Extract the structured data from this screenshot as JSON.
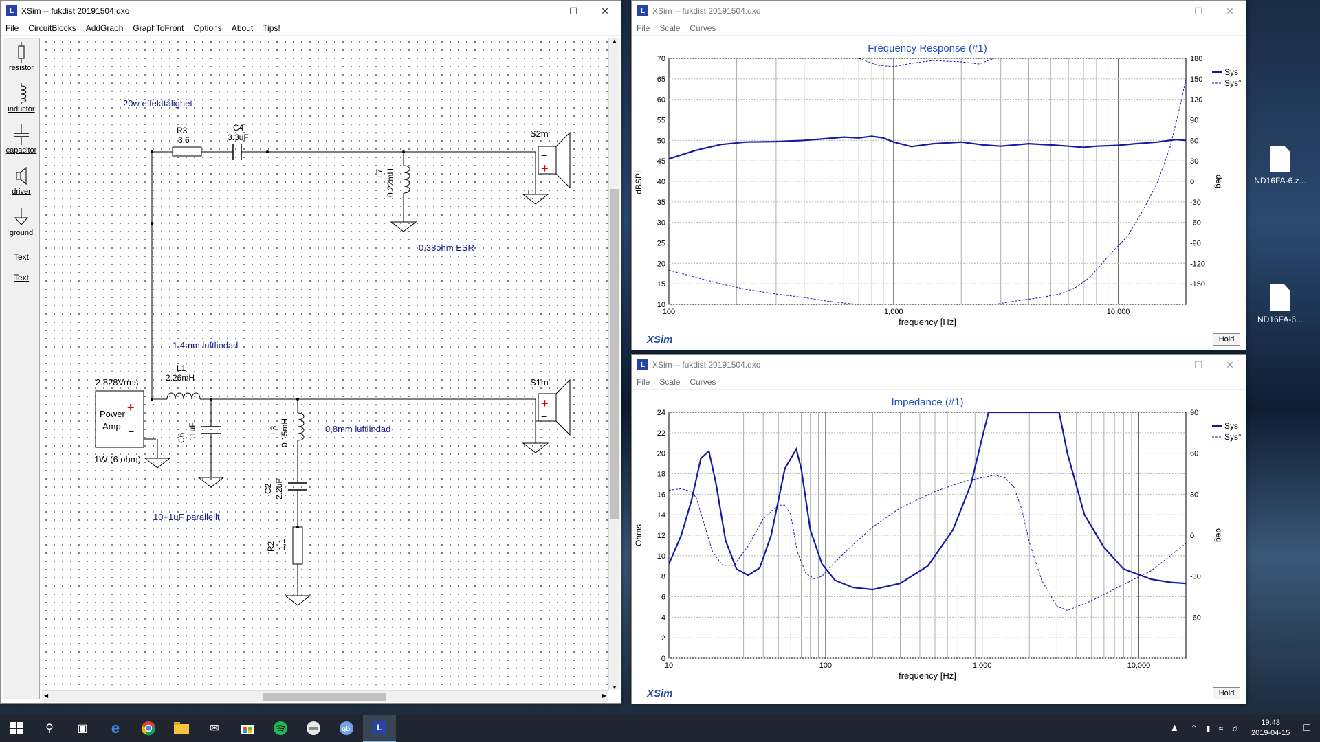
{
  "main_window": {
    "title": "XSim -- fukdist 20191504.dxo",
    "menu": [
      "File",
      "CircuitBlocks",
      "AddGraph",
      "GraphToFront",
      "Options",
      "About",
      "Tips!"
    ],
    "tools": [
      {
        "label": "resistor",
        "icon": "resistor-icon"
      },
      {
        "label": "inductor",
        "icon": "inductor-icon"
      },
      {
        "label": "capacitor",
        "icon": "capacitor-icon"
      },
      {
        "label": "driver",
        "icon": "driver-icon"
      },
      {
        "label": "ground",
        "icon": "ground-icon"
      },
      {
        "label": "Text",
        "icon": "text-glyph"
      },
      {
        "label": "Text",
        "icon": "text-underlined"
      }
    ],
    "annotations": {
      "power": "20w effekttålighet",
      "esr": "0,38ohm ESR",
      "l1_note": "1,4mm luftlindad",
      "l3_note": "0,8mm luftlindad",
      "c6_note": "10+1uF parallellt"
    },
    "components": {
      "r3": {
        "name": "R3",
        "value": "3.6"
      },
      "c4": {
        "name": "C4",
        "value": "3.3uF"
      },
      "l7": {
        "name": "L7",
        "value": "0.22mH"
      },
      "s2m": {
        "name": "S2m"
      },
      "l1": {
        "name": "L1",
        "value": "2.26mH"
      },
      "c6": {
        "name": "C6",
        "value": "11uF"
      },
      "l3": {
        "name": "L3",
        "value": "0.15mH"
      },
      "c2": {
        "name": "C2",
        "value": "2.2uF"
      },
      "r2": {
        "name": "R2",
        "value": "1.1"
      },
      "s1m": {
        "name": "S1m"
      },
      "amp": {
        "line1": "Power",
        "line2": "Amp",
        "voltage": "2.828Vrms",
        "load": "1W (6 ohm)"
      }
    }
  },
  "freq_window": {
    "title": "XSim -- fukdist 20191504.dxo",
    "menu": [
      "File",
      "Scale",
      "Curves"
    ],
    "logo": "XSim",
    "hold": "Hold",
    "chart_data": {
      "type": "line",
      "title": "Frequency Response (#1)",
      "xlabel": "frequency [Hz]",
      "ylabel": "dBSPL",
      "y2label": "deg",
      "xscale": "log",
      "xlim": [
        100,
        20000
      ],
      "ylim": [
        10,
        70
      ],
      "y2lim": [
        -180,
        180
      ],
      "x_ticks": [
        "100",
        "1,000",
        "10,000"
      ],
      "y_ticks": [
        "70",
        "65",
        "60",
        "55",
        "50",
        "45",
        "40",
        "35",
        "30",
        "25",
        "20",
        "15",
        "10"
      ],
      "y2_ticks": [
        "180",
        "150",
        "120",
        "90",
        "60",
        "30",
        "0",
        "-30",
        "-60",
        "-90",
        "-120",
        "-150"
      ],
      "legend": [
        "Sys",
        "Sys°"
      ],
      "grid": true,
      "series": [
        {
          "name": "Sys",
          "axis": "left",
          "style": "solid-thick",
          "color": "#1a1aa0",
          "x": [
            100,
            130,
            170,
            220,
            300,
            400,
            500,
            600,
            700,
            800,
            900,
            1000,
            1200,
            1500,
            2000,
            2500,
            3000,
            4000,
            5000,
            6000,
            7000,
            8000,
            10000,
            12000,
            15000,
            18000,
            20000
          ],
          "y": [
            45.5,
            47.5,
            49,
            49.6,
            49.7,
            50,
            50.4,
            50.8,
            50.6,
            51,
            50.6,
            49.6,
            48.5,
            49.2,
            49.6,
            48.9,
            48.6,
            49.2,
            48.9,
            48.6,
            48.3,
            48.6,
            48.8,
            49.2,
            49.6,
            50.2,
            50
          ]
        },
        {
          "name": "Sys°",
          "axis": "right",
          "style": "dashed-thin",
          "color": "#1a1aa0",
          "x": [
            100,
            130,
            170,
            220,
            300,
            400,
            500,
            600,
            690,
            700,
            850,
            1000,
            1200,
            1500,
            2000,
            2400,
            2800,
            2820,
            3500,
            4500,
            5500,
            6500,
            7500,
            9000,
            11000,
            13000,
            15000,
            17000,
            19000,
            20000
          ],
          "y": [
            -130,
            -140,
            -150,
            -158,
            -165,
            -170,
            -175,
            -178,
            -180,
            180,
            170,
            168,
            173,
            177,
            175,
            172,
            180,
            -180,
            -175,
            -170,
            -165,
            -155,
            -140,
            -110,
            -80,
            -40,
            0,
            50,
            115,
            150
          ]
        }
      ]
    }
  },
  "imp_window": {
    "title": "XSim -- fukdist 20191504.dxo",
    "menu": [
      "File",
      "Scale",
      "Curves"
    ],
    "logo": "XSim",
    "hold": "Hold",
    "chart_data": {
      "type": "line",
      "title": "Impedance (#1)",
      "xlabel": "frequency [Hz]",
      "ylabel": "Ohms",
      "y2label": "deg",
      "xscale": "log",
      "xlim": [
        10,
        20000
      ],
      "ylim": [
        0,
        24
      ],
      "y2lim": [
        -90,
        90
      ],
      "x_ticks": [
        "10",
        "100",
        "1,000",
        "10,000"
      ],
      "y_ticks": [
        "24",
        "22",
        "20",
        "18",
        "16",
        "14",
        "12",
        "10",
        "8",
        "6",
        "4",
        "2",
        "0"
      ],
      "y2_ticks": [
        "90",
        "60",
        "30",
        "0",
        "-30",
        "-60"
      ],
      "legend": [
        "Sys",
        "Sys°"
      ],
      "grid": true,
      "series": [
        {
          "name": "Sys",
          "axis": "left",
          "style": "solid-thick",
          "color": "#1a1aa0",
          "x": [
            10,
            12,
            14,
            16,
            18,
            20,
            23,
            27,
            32,
            38,
            45,
            55,
            65,
            70,
            80,
            95,
            115,
            150,
            200,
            300,
            450,
            650,
            850,
            1000,
            1100,
            1150,
            3100,
            3500,
            4500,
            6000,
            8000,
            12000,
            16000,
            20000
          ],
          "y": [
            9.2,
            12,
            15.5,
            19.5,
            20.2,
            17,
            11.5,
            8.7,
            8.1,
            8.8,
            12,
            18.5,
            20.4,
            18.5,
            12.5,
            9.2,
            7.6,
            6.9,
            6.7,
            7.3,
            9,
            12.5,
            17,
            21.5,
            24,
            24,
            24,
            20,
            14,
            10.8,
            8.7,
            7.7,
            7.4,
            7.3
          ]
        },
        {
          "name": "Sys°",
          "axis": "right",
          "style": "dashed-thin",
          "color": "#1a1aa0",
          "x": [
            10,
            12,
            14,
            15,
            16,
            17,
            19,
            22,
            26,
            32,
            40,
            50,
            55,
            60,
            66,
            75,
            85,
            95,
            110,
            140,
            200,
            300,
            500,
            800,
            1000,
            1200,
            1400,
            1600,
            1800,
            2000,
            2400,
            3000,
            3500,
            5000,
            8000,
            12000,
            20000
          ],
          "y": [
            33,
            34,
            32,
            27,
            16,
            6,
            -12,
            -22,
            -22,
            -8,
            12,
            22,
            22,
            15,
            -12,
            -28,
            -32,
            -30,
            -22,
            -10,
            6,
            20,
            32,
            40,
            42,
            44,
            42,
            35,
            18,
            -5,
            -33,
            -52,
            -55,
            -48,
            -36,
            -26,
            -6
          ]
        }
      ]
    }
  },
  "desktop": {
    "files": [
      "ND16FA-6.z...",
      "ND16FA-6..."
    ]
  },
  "taskbar": {
    "time": "19:43",
    "date": "2019-04-15"
  }
}
